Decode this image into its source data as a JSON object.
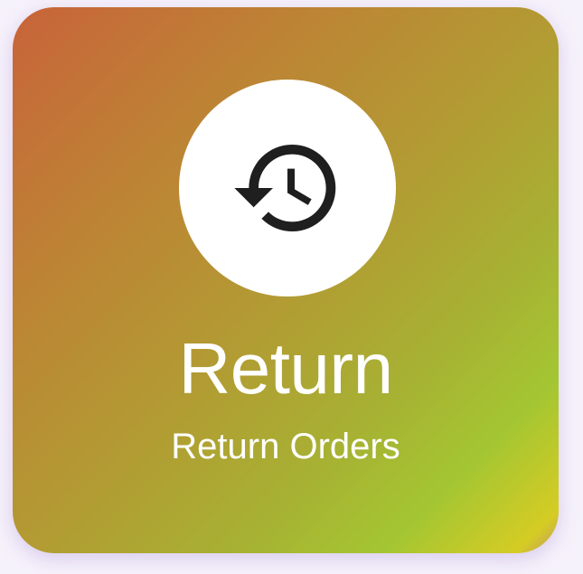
{
  "card": {
    "title": "Return",
    "subtitle": "Return Orders",
    "icon": "history-icon",
    "gradient_colors": [
      "#c8633a",
      "#b39a33",
      "#a4c632",
      "#d5cc24"
    ],
    "text_color": "#ffffff",
    "icon_background": "#ffffff",
    "icon_color": "#1f1f1f"
  }
}
